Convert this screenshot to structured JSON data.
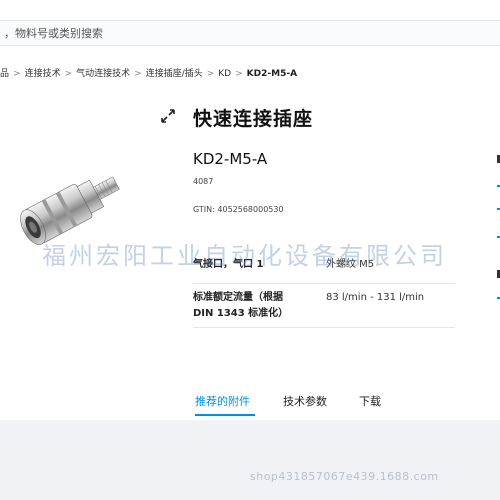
{
  "search": {
    "placeholder": "，物料号或类别搜索"
  },
  "breadcrumb": {
    "items": [
      "品",
      "连接技术",
      "气动连接技术",
      "连接插座/插头",
      "KD"
    ],
    "separator": ">",
    "current": "KD2-M5-A"
  },
  "product": {
    "title": "快速连接插座",
    "part_number": "KD2-M5-A",
    "code": "4087",
    "gtin": "GTIN: 4052568000530"
  },
  "specs": [
    {
      "label": "气接口，气口 1",
      "value": "外螺纹 M5"
    },
    {
      "label": "标准额定流量（根据\nDIN 1343 标准化）",
      "value": "83 l/min - 131 l/min"
    }
  ],
  "tabs": [
    {
      "label": "推荐的附件",
      "active": true
    },
    {
      "label": "技术参数",
      "active": false
    },
    {
      "label": "下载",
      "active": false
    }
  ],
  "watermark": {
    "main": "福州宏阳工业自动化设备有限公司",
    "footer": "shop431857067e439.1688.com"
  },
  "colors": {
    "accent": "#0091dc",
    "footer_bg": "#f0f2f5"
  },
  "icons": {
    "expand": "expand-arrows-icon"
  }
}
